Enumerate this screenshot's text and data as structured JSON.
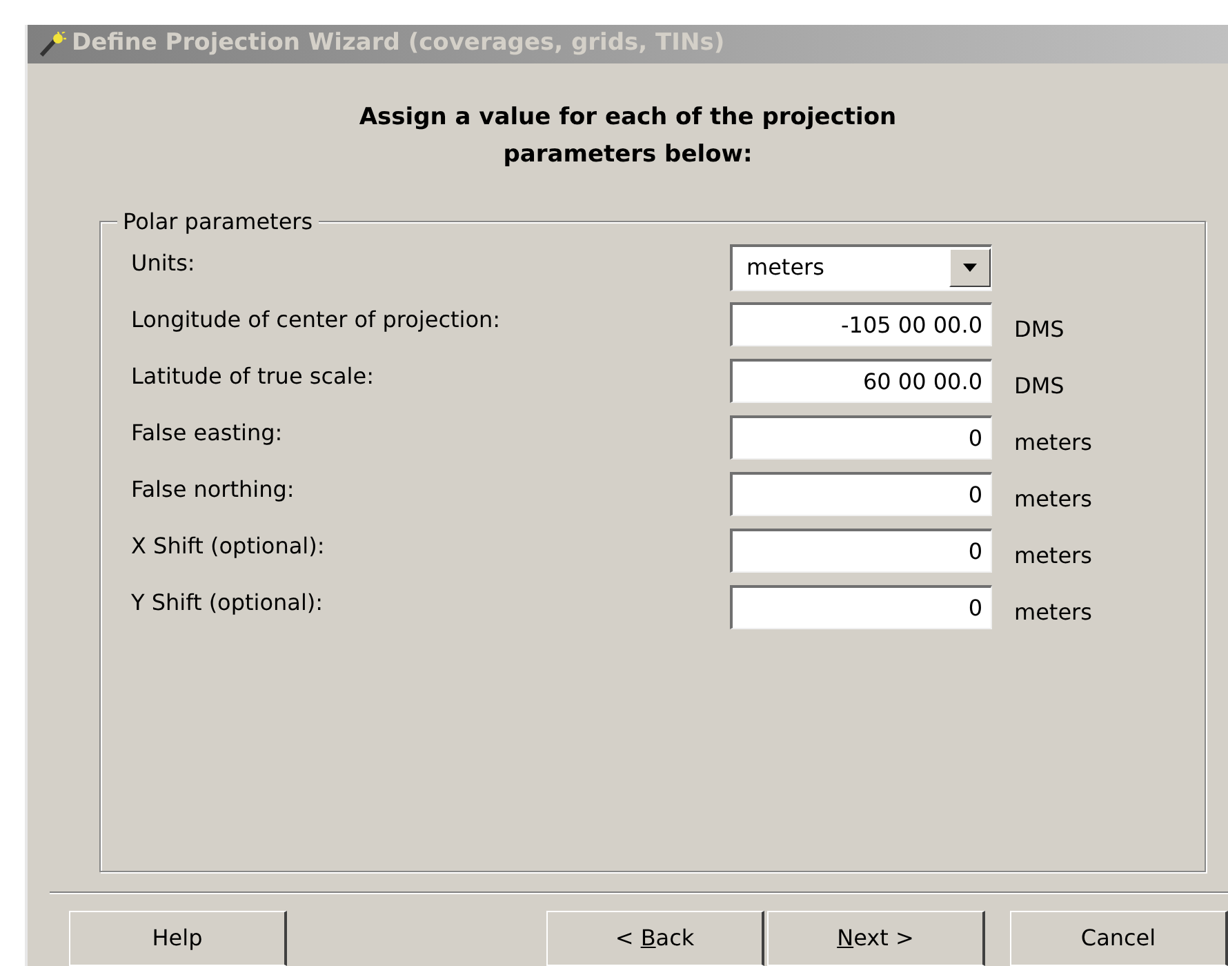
{
  "window": {
    "title": "Define Projection Wizard (coverages, grids, TINs)",
    "active": false
  },
  "heading": "Assign a value for each of the projection parameters below:",
  "group": {
    "title": "Polar parameters",
    "rows": [
      {
        "kind": "dropdown",
        "label": "Units:",
        "value": "meters"
      },
      {
        "kind": "text",
        "label": "Longitude of center of projection:",
        "value": "-105 00 00.0",
        "unit": "DMS"
      },
      {
        "kind": "text",
        "label": "Latitude of true scale:",
        "value": "60 00 00.0",
        "unit": "DMS"
      },
      {
        "kind": "text",
        "label": "False easting:",
        "value": "0",
        "unit": "meters"
      },
      {
        "kind": "text",
        "label": "False northing:",
        "value": "0",
        "unit": "meters"
      },
      {
        "kind": "text",
        "label": "X Shift (optional):",
        "value": "0",
        "unit": "meters"
      },
      {
        "kind": "text",
        "label": "Y Shift (optional):",
        "value": "0",
        "unit": "meters"
      }
    ]
  },
  "buttons": [
    {
      "before": "Help"
    },
    {
      "before": "< ",
      "key": "B",
      "after": "ack"
    },
    {
      "key": "N",
      "after": "ext >"
    },
    {
      "before": "Cancel"
    }
  ]
}
